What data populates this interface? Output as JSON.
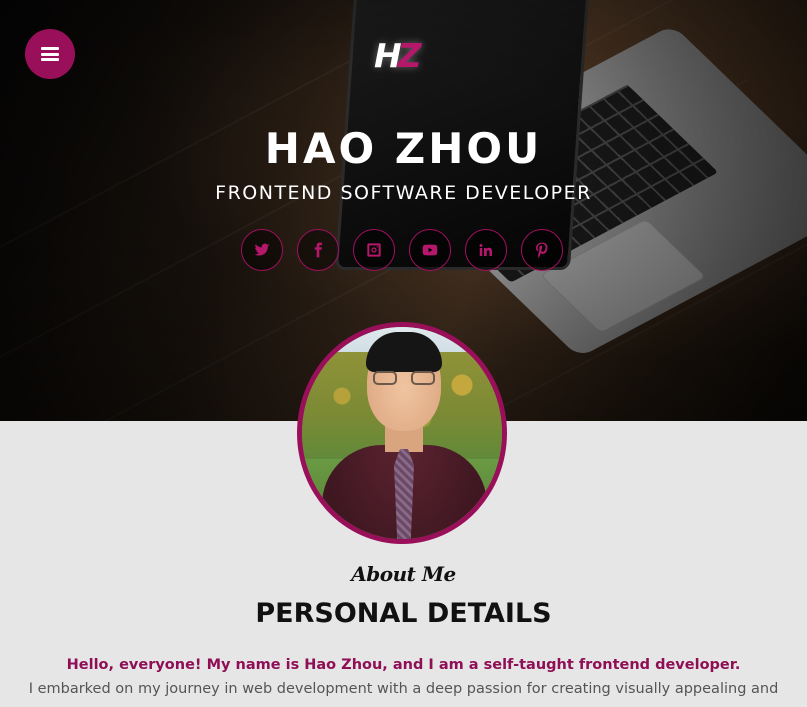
{
  "header": {
    "logo": {
      "first": "H",
      "second": "Z"
    },
    "name": "HAO ZHOU",
    "role": "FRONTEND SOFTWARE DEVELOPER",
    "menu_icon": "hamburger-menu-icon",
    "accent_color": "#9a0f5a"
  },
  "socials": [
    {
      "network": "twitter",
      "icon": "twitter-icon"
    },
    {
      "network": "facebook",
      "icon": "facebook-icon"
    },
    {
      "network": "instagram",
      "icon": "instagram-icon"
    },
    {
      "network": "youtube",
      "icon": "youtube-icon"
    },
    {
      "network": "linkedin",
      "icon": "linkedin-icon"
    },
    {
      "network": "pinterest",
      "icon": "pinterest-icon"
    }
  ],
  "about": {
    "script_label": "About Me",
    "title": "PERSONAL DETAILS",
    "intro": "Hello, everyone! My name is Hao Zhou, and I am a self-taught frontend developer.",
    "body": "I embarked on my journey in web development with a deep passion for creating visually appealing and"
  }
}
